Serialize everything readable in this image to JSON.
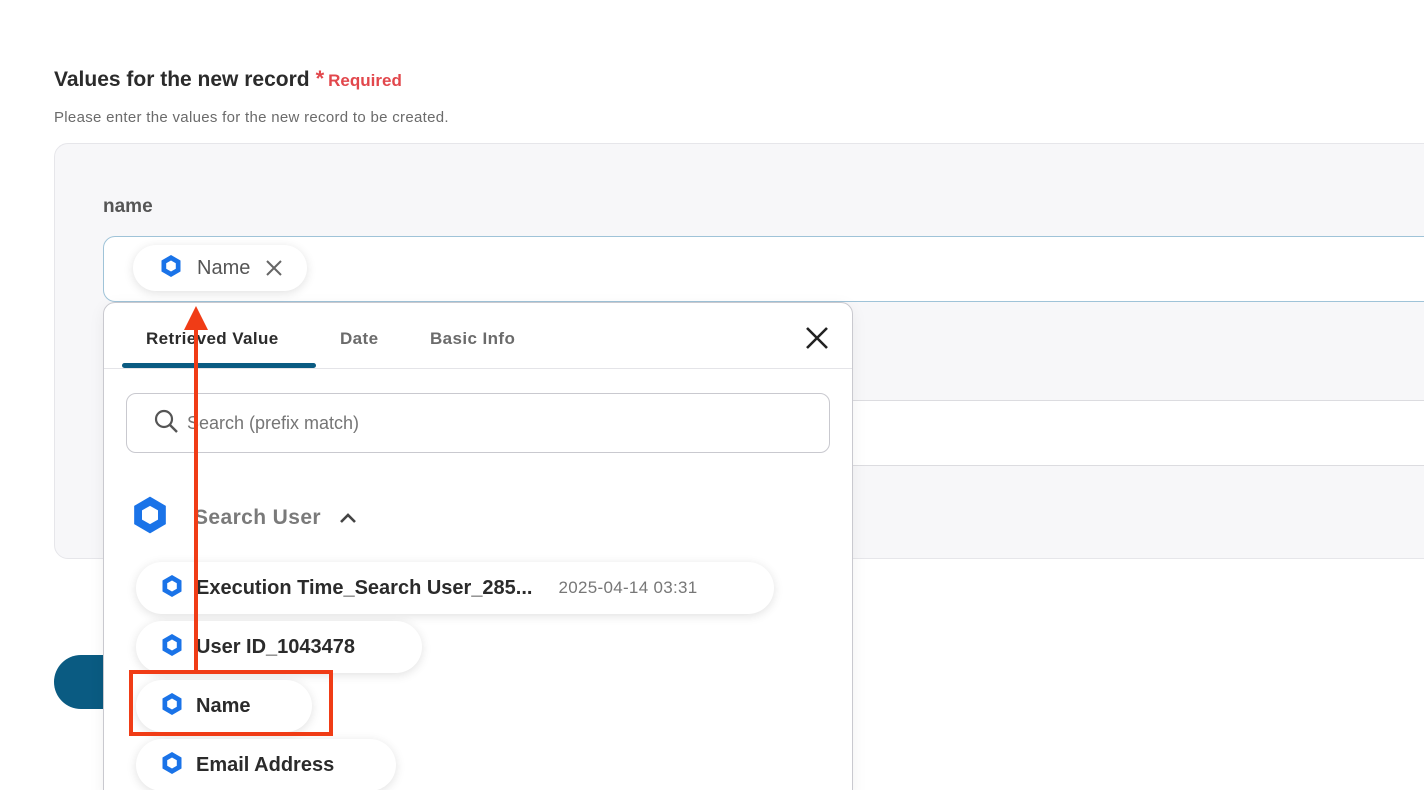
{
  "section": {
    "title": "Values for the new record",
    "required_mark": "*",
    "required_text": "Required",
    "description": "Please enter the values for the new record to be created."
  },
  "field": {
    "label": "name",
    "chip_label": "Name"
  },
  "dropdown": {
    "tabs": [
      {
        "label": "Retrieved Value",
        "active": true
      },
      {
        "label": "Date",
        "active": false
      },
      {
        "label": "Basic Info",
        "active": false
      }
    ],
    "search_placeholder": "Search (prefix match)",
    "group": {
      "label": "Search User",
      "expanded": true,
      "items": [
        {
          "label": "Execution Time_Search User_285...",
          "value": "2025-04-14 03:31"
        },
        {
          "label": "User ID_1043478",
          "value": ""
        },
        {
          "label": "Name",
          "value": ""
        },
        {
          "label": "Email Address",
          "value": ""
        }
      ]
    }
  },
  "colors": {
    "accent": "#0a5b82",
    "required": "#e2474c",
    "annotation": "#f03c16",
    "icon_blue": "#1a73e8"
  }
}
